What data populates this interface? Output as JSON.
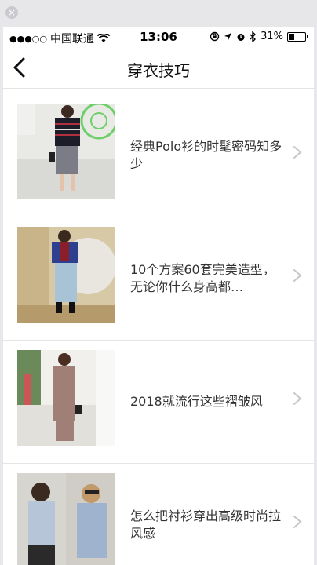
{
  "status": {
    "carrier": "中国联通",
    "time": "13:06",
    "battery": "31%",
    "battery_level": 0.31
  },
  "nav": {
    "title": "穿衣技巧"
  },
  "items": [
    {
      "title": "经典Polo衫的时髦密码知多少"
    },
    {
      "title": "10个方案60套完美造型，无论你什么身高都…"
    },
    {
      "title": "2018就流行这些褶皱风"
    },
    {
      "title": "怎么把衬衫穿出高级时尚拉风感"
    }
  ],
  "colors": {
    "background": "#ffffff",
    "divider": "#e5e5e5",
    "text": "#333333",
    "chevron": "#c7c7cc"
  }
}
